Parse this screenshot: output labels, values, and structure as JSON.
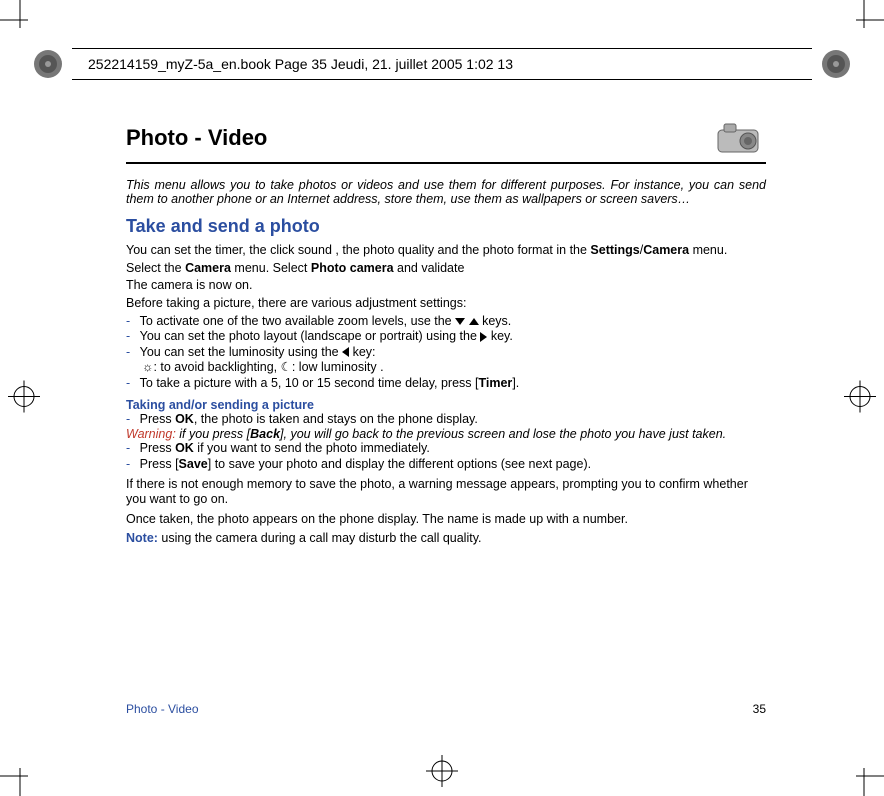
{
  "header": {
    "text": "252214159_myZ-5a_en.book  Page 35  Jeudi, 21. juillet 2005  1:02 13"
  },
  "title": "Photo - Video",
  "intro": "This menu allows you to take photos or videos and use them for different purposes. For instance, you can send them to another phone or an Internet address, store them, use them as wallpapers or screen savers…",
  "h2": "Take and send a photo",
  "p1_a": "You can set the timer, the click sound , the photo quality and the photo format in the ",
  "p1_b": "Settings",
  "p1_c": "/",
  "p1_d": "Camera",
  "p1_e": " menu.",
  "p2_a": "Select the ",
  "p2_b": "Camera",
  "p2_c": " menu. Select ",
  "p2_d": "Photo camera",
  "p2_e": " and validate",
  "p3": "The camera is now on.",
  "p4": "Before taking a picture, there are various adjustment settings:",
  "b1_a": "To activate one of the two available zoom levels, use the ",
  "b1_b": " keys.",
  "b2_a": "You can set the photo layout (landscape or portrait) using the ",
  "b2_b": " key.",
  "b3_a": "You can set the luminosity using the ",
  "b3_b": " key:",
  "b3_line2": " : to avoid backlighting,  : low luminosity .",
  "b4_a": "To take a picture with a 5, 10 or 15 second time delay, press [",
  "b4_b": "Timer",
  "b4_c": "].",
  "subhead1": "Taking and/or sending a picture",
  "s1_a": "Press ",
  "s1_b": "OK",
  "s1_c": ", the photo is taken and stays on the phone display.",
  "warn_label": "Warning:",
  "warn_a": " if you press [",
  "warn_b": "Back",
  "warn_c": "], you will go back to the previous screen and lose the photo you have just taken.",
  "s2_a": "Press ",
  "s2_b": "OK",
  "s2_c": " if you want to send the photo immediately.",
  "s3_a": "Press [",
  "s3_b": "Save",
  "s3_c": "] to save your photo and display the different options (see next page).",
  "p5": "If there is not enough memory to save the photo, a warning message appears, prompting you to confirm whether you want to go on.",
  "p6": "Once taken, the photo appears on the phone display. The name is made up with a number.",
  "note_label": "Note:",
  "note_text": " using the camera during a call may disturb the call quality.",
  "footer": {
    "section": "Photo - Video",
    "page": "35"
  }
}
